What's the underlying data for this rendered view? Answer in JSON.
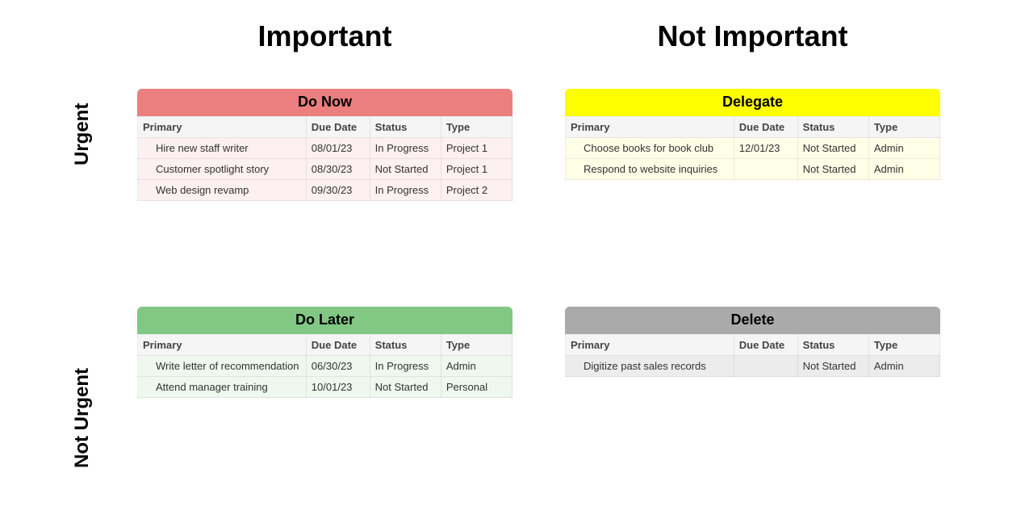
{
  "column_headers": {
    "important": "Important",
    "not_important": "Not Important"
  },
  "row_headers": {
    "urgent": "Urgent",
    "not_urgent": "Not Urgent"
  },
  "table_headers": {
    "primary": "Primary",
    "due_date": "Due Date",
    "status": "Status",
    "type": "Type"
  },
  "quadrants": {
    "do_now": {
      "title": "Do Now",
      "rows": [
        {
          "primary": "Hire new staff writer",
          "due_date": "08/01/23",
          "status": "In Progress",
          "type": "Project 1"
        },
        {
          "primary": "Customer spotlight story",
          "due_date": "08/30/23",
          "status": "Not Started",
          "type": "Project 1"
        },
        {
          "primary": "Web design revamp",
          "due_date": "09/30/23",
          "status": "In Progress",
          "type": "Project 2"
        }
      ]
    },
    "delegate": {
      "title": "Delegate",
      "rows": [
        {
          "primary": "Choose books for book club",
          "due_date": "12/01/23",
          "status": "Not Started",
          "type": "Admin"
        },
        {
          "primary": "Respond to website inquiries",
          "due_date": "",
          "status": "Not Started",
          "type": "Admin"
        }
      ]
    },
    "do_later": {
      "title": "Do Later",
      "rows": [
        {
          "primary": "Write letter of recommendation",
          "due_date": "06/30/23",
          "status": "In Progress",
          "type": "Admin"
        },
        {
          "primary": "Attend manager training",
          "due_date": "10/01/23",
          "status": "Not Started",
          "type": "Personal"
        }
      ]
    },
    "delete": {
      "title": "Delete",
      "rows": [
        {
          "primary": "Digitize past sales records",
          "due_date": "",
          "status": "Not Started",
          "type": "Admin"
        }
      ]
    }
  }
}
